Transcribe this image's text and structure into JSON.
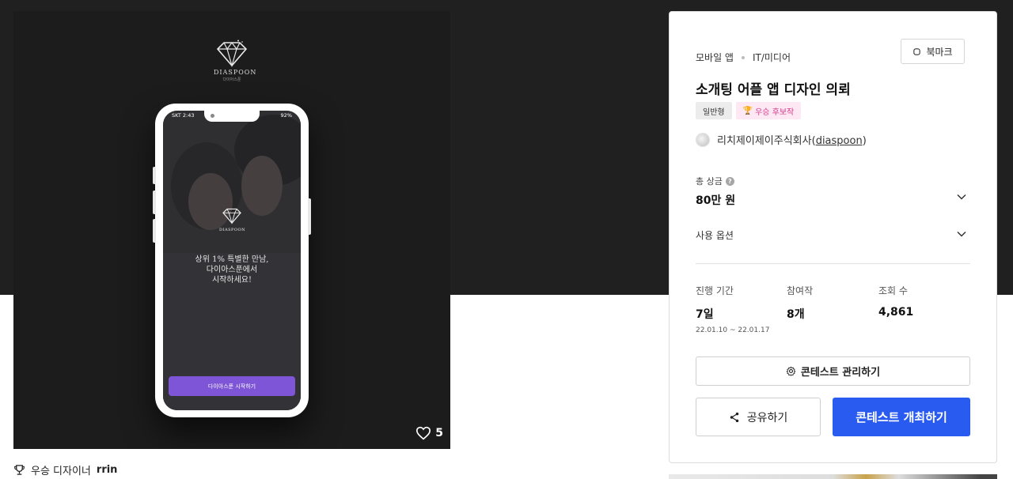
{
  "preview": {
    "brand_name": "DIASPOON",
    "brand_sub": "다이아스푼",
    "status_left": "SKT 2:43",
    "status_right": "92%",
    "tagline_line1": "상위 1% 특별한 만남,",
    "tagline_line2": "다이아스푼에서",
    "tagline_line3": "시작하세요!",
    "cta_label": "다이아스푼 시작하기",
    "like_count": "5"
  },
  "winner": {
    "label": "우승 디자이너",
    "name": "rrin"
  },
  "contest": {
    "category_1": "모바일 앱",
    "category_2": "IT/미디어",
    "bookmark_label": "북마크",
    "title": "소개팅 어플 앱 디자인 의뢰",
    "tag_type": "일반형",
    "tag_award": "우승 후보작",
    "host_name": "리치제이제이주식회사",
    "host_handle": "diaspoon",
    "prize_label": "총 상금",
    "prize_value": "80만 원",
    "option_label": "사용 옵션",
    "period_label": "진행 기간",
    "period_value": "7일",
    "period_range": "22.01.10 ~ 22.01.17",
    "entries_label": "참여작",
    "entries_value": "8개",
    "views_label": "조회 수",
    "views_value": "4,861",
    "manage_label": "콘테스트 관리하기",
    "share_label": "공유하기",
    "host_button_label": "콘테스트 개최하기"
  },
  "colors": {
    "primary": "#2a5bf0",
    "cta_purple": "#7d55d6",
    "award_pink": "#d43b8c"
  }
}
